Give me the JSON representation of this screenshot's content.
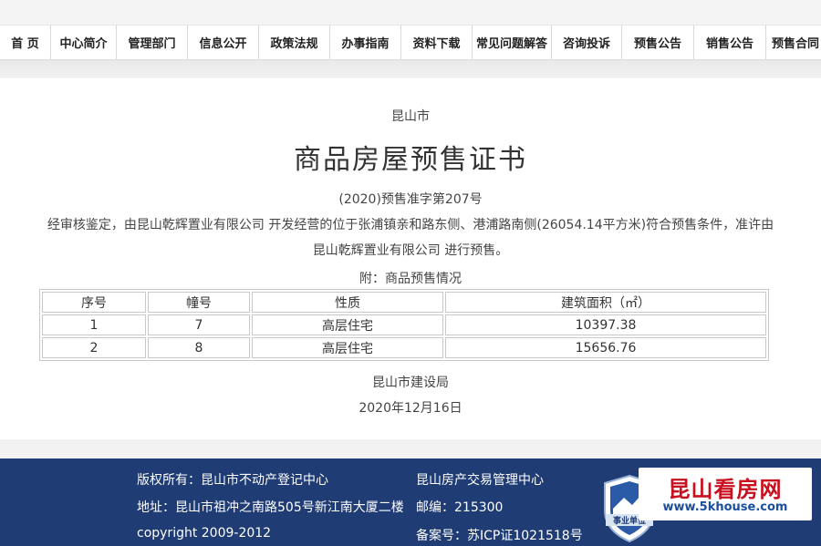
{
  "nav": {
    "items": [
      {
        "label": "首 页"
      },
      {
        "label": "中心简介"
      },
      {
        "label": "管理部门"
      },
      {
        "label": "信息公开"
      },
      {
        "label": "政策法规"
      },
      {
        "label": "办事指南"
      },
      {
        "label": "资料下载"
      },
      {
        "label": "常见问题解答"
      },
      {
        "label": "咨询投诉"
      },
      {
        "label": "预售公告"
      },
      {
        "label": "销售公告"
      },
      {
        "label": "预售合同"
      }
    ]
  },
  "certificate": {
    "city": "昆山市",
    "title": "商品房屋预售证书",
    "number": "(2020)预售准字第207号",
    "description": "经审核鉴定，由昆山乾辉置业有限公司 开发经营的位于张浦镇亲和路东侧、港浦路南侧(26054.14平方米)符合预售条件，准许由昆山乾辉置业有限公司 进行预售。",
    "attachment_label": "附：商品预售情况",
    "table": {
      "headers": [
        "序号",
        "幢号",
        "性质",
        "建筑面积（㎡）"
      ],
      "rows": [
        [
          "1",
          "7",
          "高层住宅",
          "10397.38"
        ],
        [
          "2",
          "8",
          "高层住宅",
          "15656.76"
        ]
      ]
    },
    "issuer": "昆山市建设局",
    "date": "2020年12月16日"
  },
  "footer": {
    "copyright_owner": "版权所有：昆山市不动产登记中心",
    "center_name": "昆山房产交易管理中心",
    "address": "地址：昆山市祖冲之南路505号新江南大厦二楼",
    "postcode": "邮编：215300",
    "copyright": "copyright 2009-2012",
    "icp": "备案号：苏ICP证1021518号",
    "emblem_text": "事业单位",
    "logo_text": "昆山看房网",
    "logo_url": "www.5khouse.com",
    "colors": {
      "footer_bg": "#1f3c74",
      "logo_red": "#c8101e",
      "logo_blue": "#1a4fa0"
    }
  }
}
